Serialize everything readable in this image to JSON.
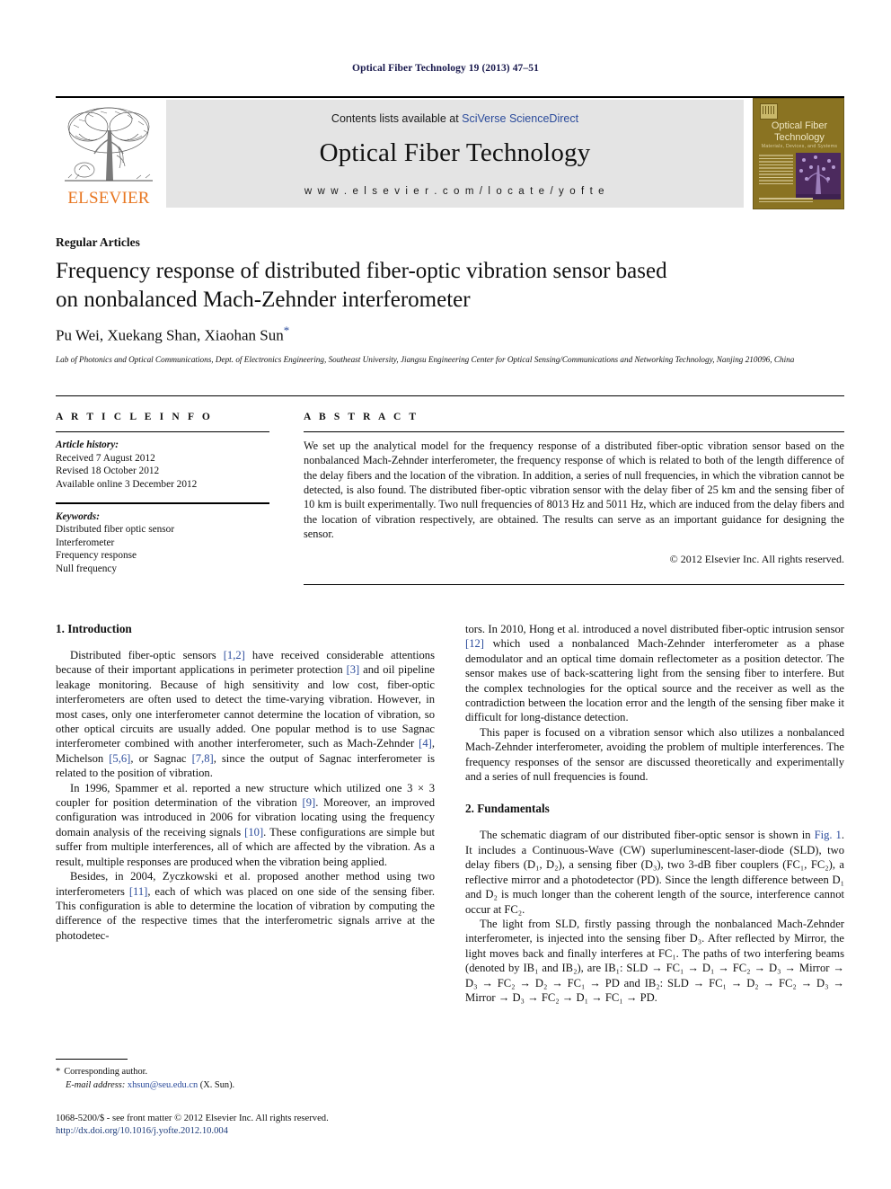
{
  "running_head": "Optical Fiber Technology 19 (2013) 47–51",
  "masthead": {
    "publisher_wordmark": "ELSEVIER",
    "contents_prefix": "Contents lists available at ",
    "contents_link": "SciVerse ScienceDirect",
    "journal_name": "Optical Fiber Technology",
    "journal_url": "w w w . e l s e v i e r . c o m / l o c a t e / y o f t e",
    "cover": {
      "title_line1": "Optical Fiber",
      "title_line2": "Technology",
      "subtitle": "Materials, Devices, and Systems"
    }
  },
  "article": {
    "section_kind": "Regular Articles",
    "title_line1": "Frequency response of distributed fiber-optic vibration sensor based",
    "title_line2": "on nonbalanced Mach-Zehnder interferometer",
    "authors": "Pu Wei, Xuekang Shan, Xiaohan Sun",
    "corresponding_marker": "*",
    "affiliation": "Lab of Photonics and Optical Communications, Dept. of Electronics Engineering, Southeast University, Jiangsu Engineering Center for Optical Sensing/Communications and Networking Technology, Nanjing 210096, China"
  },
  "article_info": {
    "heading": "A R T I C L E   I N F O",
    "history_label": "Article history:",
    "history": [
      "Received 7 August 2012",
      "Revised 18 October 2012",
      "Available online 3 December 2012"
    ],
    "keywords_label": "Keywords:",
    "keywords": [
      "Distributed fiber optic sensor",
      "Interferometer",
      "Frequency response",
      "Null frequency"
    ]
  },
  "abstract": {
    "heading": "A B S T R A C T",
    "text": "We set up the analytical model for the frequency response of a distributed fiber-optic vibration sensor based on the nonbalanced Mach-Zehnder interferometer, the frequency response of which is related to both of the length difference of the delay fibers and the location of the vibration. In addition, a series of null frequencies, in which the vibration cannot be detected, is also found. The distributed fiber-optic vibration sensor with the delay fiber of 25 km and the sensing fiber of 10 km is built experimentally. Two null frequencies of 8013 Hz and 5011 Hz, which are induced from the delay fibers and the location of vibration respectively, are obtained. The results can serve as an important guidance for designing the sensor.",
    "copyright": "© 2012 Elsevier Inc. All rights reserved."
  },
  "body": {
    "intro_heading": "1. Introduction",
    "intro_p1_a": "Distributed fiber-optic sensors ",
    "intro_p1_r1": "[1,2]",
    "intro_p1_b": " have received considerable attentions because of their important applications in perimeter protection ",
    "intro_p1_r2": "[3]",
    "intro_p1_c": " and oil pipeline leakage monitoring. Because of high sensitivity and low cost, fiber-optic interferometers are often used to detect the time-varying vibration. However, in most cases, only one interferometer cannot determine the location of vibration, so other optical circuits are usually added. One popular method is to use Sagnac interferometer combined with another interferometer, such as Mach-Zehnder ",
    "intro_p1_r3": "[4]",
    "intro_p1_d": ", Michelson ",
    "intro_p1_r4": "[5,6]",
    "intro_p1_e": ", or Sagnac ",
    "intro_p1_r5": "[7,8]",
    "intro_p1_f": ", since the output of Sagnac interferometer is related to the position of vibration.",
    "intro_p2_a": "In 1996, Spammer et al. reported a new structure which utilized one 3 × 3 coupler for position determination of the vibration ",
    "intro_p2_r1": "[9]",
    "intro_p2_b": ". Moreover, an improved configuration was introduced in 2006 for vibration locating using the frequency domain analysis of the receiving signals ",
    "intro_p2_r2": "[10]",
    "intro_p2_c": ". These configurations are simple but suffer from multiple interferences, all of which are affected by the vibration. As a result, multiple responses are produced when the vibration being applied.",
    "intro_p3_a": "Besides, in 2004, Zyczkowski et al. proposed another method using two interferometers ",
    "intro_p3_r1": "[11]",
    "intro_p3_b": ", each of which was placed on one side of the sensing fiber. This configuration is able to determine the location of vibration by computing the difference of the respective times that the interferometric signals arrive at the photodetec-",
    "right_p1_a": "tors. In 2010, Hong et al. introduced a novel distributed fiber-optic intrusion sensor ",
    "right_p1_r1": "[12]",
    "right_p1_b": " which used a nonbalanced Mach-Zehnder interferometer as a phase demodulator and an optical time domain reflectometer as a position detector. The sensor makes use of back-scattering light from the sensing fiber to interfere. But the complex technologies for the optical source and the receiver as well as the contradiction between the location error and the length of the sensing fiber make it difficult for long-distance detection.",
    "right_p2": "This paper is focused on a vibration sensor which also utilizes a nonbalanced Mach-Zehnder interferometer, avoiding the problem of multiple interferences. The frequency responses of the sensor are discussed theoretically and experimentally and a series of null frequencies is found.",
    "fund_heading": "2. Fundamentals",
    "fund_p1_a": "The schematic diagram of our distributed fiber-optic sensor is shown in ",
    "fund_p1_fig": "Fig. 1",
    "fund_p1_b": ". It includes a Continuous-Wave (CW) superluminescent-laser-diode (SLD), two delay fibers (D₁, D₂), a sensing fiber (D₃), two 3-dB fiber couplers (FC₁, FC₂), a reflective mirror and a photodetector (PD). Since the length difference between D₁ and D₂ is much longer than the coherent length of the source, interference cannot occur at FC₂.",
    "fund_p2": "The light from SLD, firstly passing through the nonbalanced Mach-Zehnder interferometer, is injected into the sensing fiber D₃. After reflected by Mirror, the light moves back and finally interferes at FC₁. The paths of two interfering beams (denoted by IB₁ and IB₂), are IB₁: SLD → FC₁ → D₁ → FC₂ → D₃ → Mirror → D₃ → FC₂ → D₂ → FC₁ → PD and IB₂: SLD → FC₁ → D₂ → FC₂ → D₃ → Mirror → D₃ → FC₂ → D₁ → FC₁ → PD."
  },
  "footnote": {
    "star": "*",
    "corresponding": "Corresponding author.",
    "email_label": "E-mail address:",
    "email": "xhsun@seu.edu.cn",
    "email_suffix": "(X. Sun)."
  },
  "publisher_footer": {
    "issn_line": "1068-5200/$ - see front matter © 2012 Elsevier Inc. All rights reserved.",
    "doi": "http://dx.doi.org/10.1016/j.yofte.2012.10.004"
  },
  "colors": {
    "link": "#2b4b9b",
    "runhead": "#19194d",
    "elsevier_orange": "#E87722",
    "masthead_bg": "#e4e4e4",
    "cover_bg": "#8a7322",
    "cover_accent": "#4c2a5e"
  }
}
